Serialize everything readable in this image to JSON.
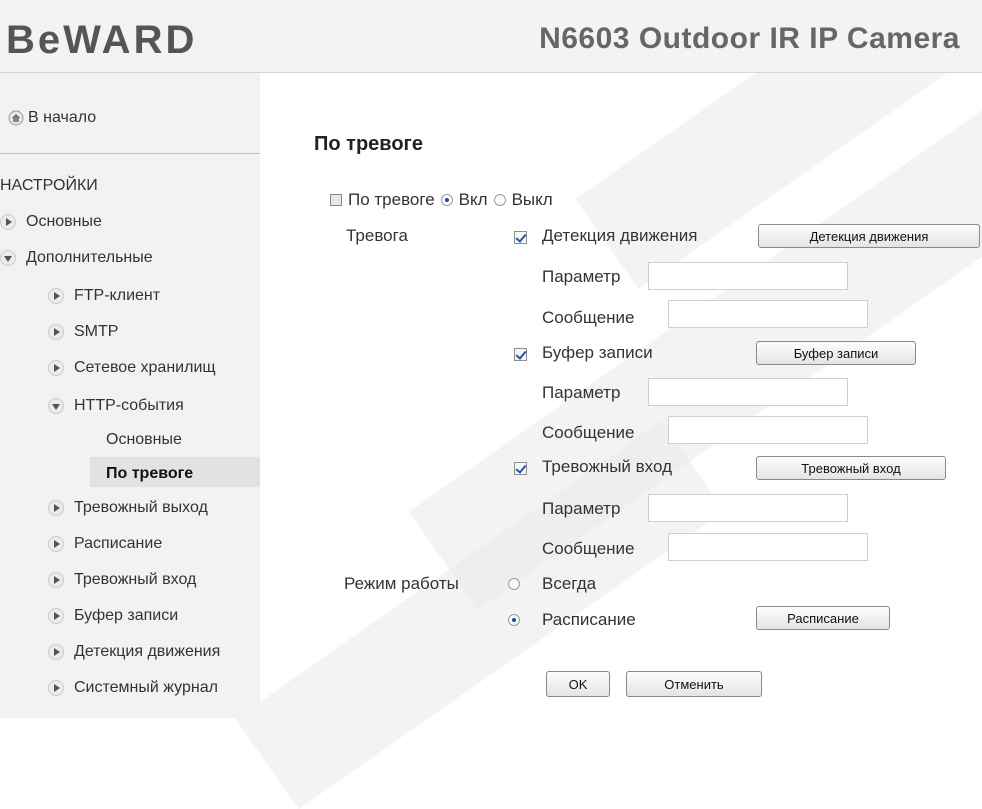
{
  "header": {
    "logo": "BeWARD",
    "model": "N6603 Outdoor IR IP Camera"
  },
  "sidebar": {
    "home": "В начало",
    "section": "НАСТРОЙКИ",
    "items": [
      {
        "label": "Основные"
      },
      {
        "label": "Дополнительные"
      },
      {
        "label": "FTP-клиент"
      },
      {
        "label": "SMTP"
      },
      {
        "label": "Сетевое хранилищ"
      },
      {
        "label": "HTTP-события"
      },
      {
        "label": "Основные"
      },
      {
        "label": "По тревоге"
      },
      {
        "label": "Тревожный выход"
      },
      {
        "label": "Расписание"
      },
      {
        "label": "Тревожный вход"
      },
      {
        "label": "Буфер записи"
      },
      {
        "label": "Детекция движения"
      },
      {
        "label": "Системный журнал"
      }
    ]
  },
  "main": {
    "title": "По тревоге",
    "toggle": {
      "label": "По тревоге",
      "on": "Вкл",
      "off": "Выкл",
      "selected": "Вкл"
    },
    "alarm_label": "Тревога",
    "triggers": [
      {
        "label": "Детекция движения",
        "button": "Детекция движения",
        "checked": true
      },
      {
        "label": "Буфер записи",
        "button": "Буфер записи",
        "checked": true
      },
      {
        "label": "Тревожный вход",
        "button": "Тревожный вход",
        "checked": true
      }
    ],
    "param_label": "Параметр",
    "message_label": "Сообщение",
    "mode_label": "Режим работы",
    "mode_always": "Всегда",
    "mode_schedule": "Расписание",
    "mode_selected": "Расписание",
    "schedule_button": "Расписание",
    "ok_button": "OK",
    "cancel_button": "Отменить"
  }
}
